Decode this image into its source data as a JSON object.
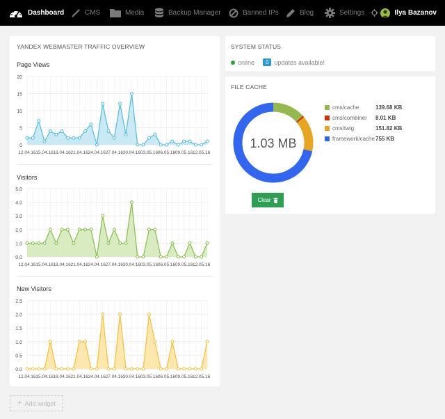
{
  "nav": {
    "items": [
      {
        "label": "Dashboard",
        "icon": "dashboard-icon",
        "active": true
      },
      {
        "label": "CMS",
        "icon": "magic-wand-icon"
      },
      {
        "label": "Media",
        "icon": "folder-icon"
      },
      {
        "label": "Backup Manager",
        "icon": "database-icon"
      },
      {
        "label": "Banned IPs",
        "icon": "ban-icon"
      },
      {
        "label": "Blog",
        "icon": "pencil-icon"
      },
      {
        "label": "Settings",
        "icon": "gear-icon"
      }
    ],
    "user": "Ilya Bazanov"
  },
  "traffic": {
    "title": "YANDEX WEBMASTER TRAFFIC OVERVIEW",
    "charts": [
      {
        "title": "Page Views",
        "color": "#5bc0de",
        "fill": "#bfe6f2",
        "ymax": 20,
        "yticks": [
          "0",
          "5",
          "10",
          "15",
          "20"
        ]
      },
      {
        "title": "Visitors",
        "color": "#8cc152",
        "fill": "#d1e8b6",
        "ymax": 5,
        "yticks": [
          "0.0",
          "1.0",
          "2.0",
          "3.0",
          "4.0",
          "5.0"
        ]
      },
      {
        "title": "New Visitors",
        "color": "#f6c342",
        "fill": "#fbe3a0",
        "ymax": 2.5,
        "yticks": [
          "0.0",
          "0.5",
          "1.0",
          "1.5",
          "2.0",
          "2.5"
        ]
      }
    ]
  },
  "chart_data": [
    {
      "type": "area",
      "title": "Page Views",
      "x": [
        "12.04.16",
        "",
        "",
        "15.04.16",
        "",
        "",
        "18.04.16",
        "",
        "",
        "21.04.16",
        "",
        "",
        "24.04.16",
        "",
        "",
        "27.04.16",
        "",
        "",
        "30.04.16",
        "",
        "",
        "03.05.16",
        "",
        "",
        "06.05.16",
        "",
        "",
        "09.05.16",
        "",
        "",
        "12.05.16",
        ""
      ],
      "values": [
        2,
        2,
        7,
        1,
        4,
        3,
        4,
        2,
        2,
        2,
        4,
        6,
        0,
        12,
        4,
        2,
        12,
        3,
        15,
        0,
        0,
        2,
        3,
        0,
        0,
        1,
        0,
        1,
        1,
        0,
        0,
        1
      ],
      "ylim": [
        0,
        20
      ]
    },
    {
      "type": "area",
      "title": "Visitors",
      "x": [
        "12.04.16",
        "",
        "",
        "15.04.16",
        "",
        "",
        "18.04.16",
        "",
        "",
        "21.04.16",
        "",
        "",
        "24.04.16",
        "",
        "",
        "27.04.16",
        "",
        "",
        "30.04.16",
        "",
        "",
        "03.05.16",
        "",
        "",
        "06.05.16",
        "",
        "",
        "09.05.16",
        "",
        "",
        "12.05.16",
        ""
      ],
      "values": [
        1,
        1,
        1,
        1,
        2,
        1,
        2,
        2,
        1,
        2,
        2,
        2,
        0,
        3,
        1,
        2,
        1,
        1,
        4,
        0,
        0,
        2,
        2,
        0,
        0,
        1,
        0,
        0,
        1,
        0,
        0,
        1
      ],
      "ylim": [
        0,
        5
      ]
    },
    {
      "type": "area",
      "title": "New Visitors",
      "x": [
        "12.04.16",
        "",
        "",
        "15.04.16",
        "",
        "",
        "18.04.16",
        "",
        "",
        "21.04.16",
        "",
        "",
        "24.04.16",
        "",
        "",
        "27.04.16",
        "",
        "",
        "30.04.16",
        "",
        "",
        "03.05.16",
        "",
        "",
        "06.05.16",
        "",
        "",
        "09.05.16",
        "",
        "",
        "12.05.16",
        ""
      ],
      "values": [
        0,
        0,
        0,
        0,
        1,
        0,
        0,
        0,
        0,
        1,
        1,
        0,
        0,
        2,
        0,
        0,
        2,
        0,
        0,
        0,
        0,
        2,
        1,
        0,
        0,
        1,
        0,
        0,
        0,
        0,
        0,
        1
      ],
      "ylim": [
        0,
        2.5
      ]
    },
    {
      "type": "pie",
      "title": "1.03 MB",
      "categories": [
        "cms/cache",
        "cms/combiner",
        "cms/twig",
        "framework/cache"
      ],
      "values": [
        139.68,
        8.01,
        151.82,
        755
      ],
      "colors": [
        "#95b850",
        "#cc3300",
        "#e6a623",
        "#3366ee"
      ]
    }
  ],
  "status": {
    "title": "SYSTEM STATUS",
    "online": "online",
    "updates_count": "0",
    "updates_text": "updates available!"
  },
  "cache": {
    "title": "FILE CACHE",
    "total": "1.03 MB",
    "items": [
      {
        "name": "cms/cache",
        "size": "139.68 KB",
        "color": "#95b850"
      },
      {
        "name": "cms/combiner",
        "size": "8.01 KB",
        "color": "#cc3300"
      },
      {
        "name": "cms/twig",
        "size": "151.82 KB",
        "color": "#e6a623"
      },
      {
        "name": "framework/cache",
        "size": "755 KB",
        "color": "#3366ee"
      }
    ],
    "clear_label": "Clear"
  },
  "add_widget": "Add widget"
}
